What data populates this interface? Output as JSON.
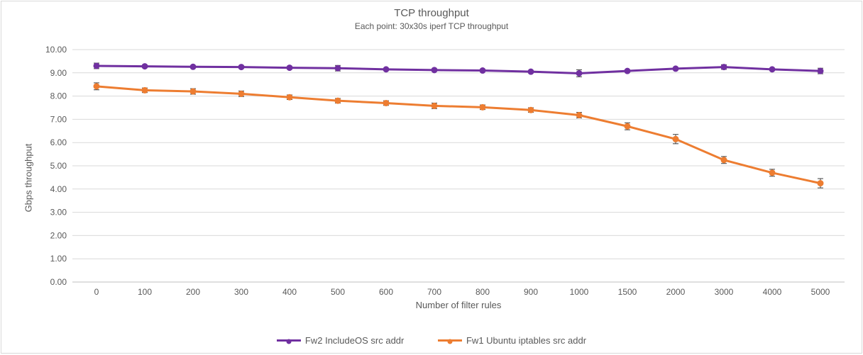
{
  "title": "TCP throughput",
  "subtitle": "Each point: 30x30s iperf TCP throughput",
  "xlabel": "Number of filter rules",
  "ylabel": "Gbps throughput",
  "colors": {
    "series_a": "#7030A0",
    "series_b": "#ED7D31",
    "grid": "#d9d9d9",
    "axis": "#bfbfbf",
    "text": "#595959",
    "err": "#404040"
  },
  "legend": {
    "a": "Fw2 IncludeOS src addr",
    "b": "Fw1 Ubuntu iptables src addr"
  },
  "chart_data": {
    "type": "line",
    "xlabel": "Number of filter rules",
    "ylabel": "Gbps throughput",
    "title": "TCP throughput",
    "ylim": [
      0,
      10
    ],
    "yticks": [
      0.0,
      1.0,
      2.0,
      3.0,
      4.0,
      5.0,
      6.0,
      7.0,
      8.0,
      9.0,
      10.0
    ],
    "categories": [
      0,
      100,
      200,
      300,
      400,
      500,
      600,
      700,
      800,
      900,
      1000,
      1500,
      2000,
      3000,
      4000,
      5000
    ],
    "series": [
      {
        "name": "Fw2 IncludeOS src addr",
        "color": "#7030A0",
        "values": [
          9.3,
          9.28,
          9.26,
          9.25,
          9.22,
          9.2,
          9.15,
          9.12,
          9.1,
          9.05,
          8.98,
          9.08,
          9.18,
          9.25,
          9.15,
          9.08
        ],
        "err": [
          0.12,
          0.0,
          0.0,
          0.0,
          0.0,
          0.12,
          0.0,
          0.0,
          0.0,
          0.0,
          0.15,
          0.0,
          0.0,
          0.1,
          0.0,
          0.12
        ]
      },
      {
        "name": "Fw1 Ubuntu iptables src addr",
        "color": "#ED7D31",
        "values": [
          8.42,
          8.25,
          8.2,
          8.1,
          7.95,
          7.8,
          7.7,
          7.58,
          7.52,
          7.4,
          7.18,
          6.7,
          6.15,
          5.25,
          4.7,
          4.25
        ],
        "err": [
          0.15,
          0.1,
          0.12,
          0.12,
          0.1,
          0.1,
          0.1,
          0.12,
          0.1,
          0.1,
          0.12,
          0.15,
          0.2,
          0.15,
          0.15,
          0.2
        ]
      }
    ]
  }
}
